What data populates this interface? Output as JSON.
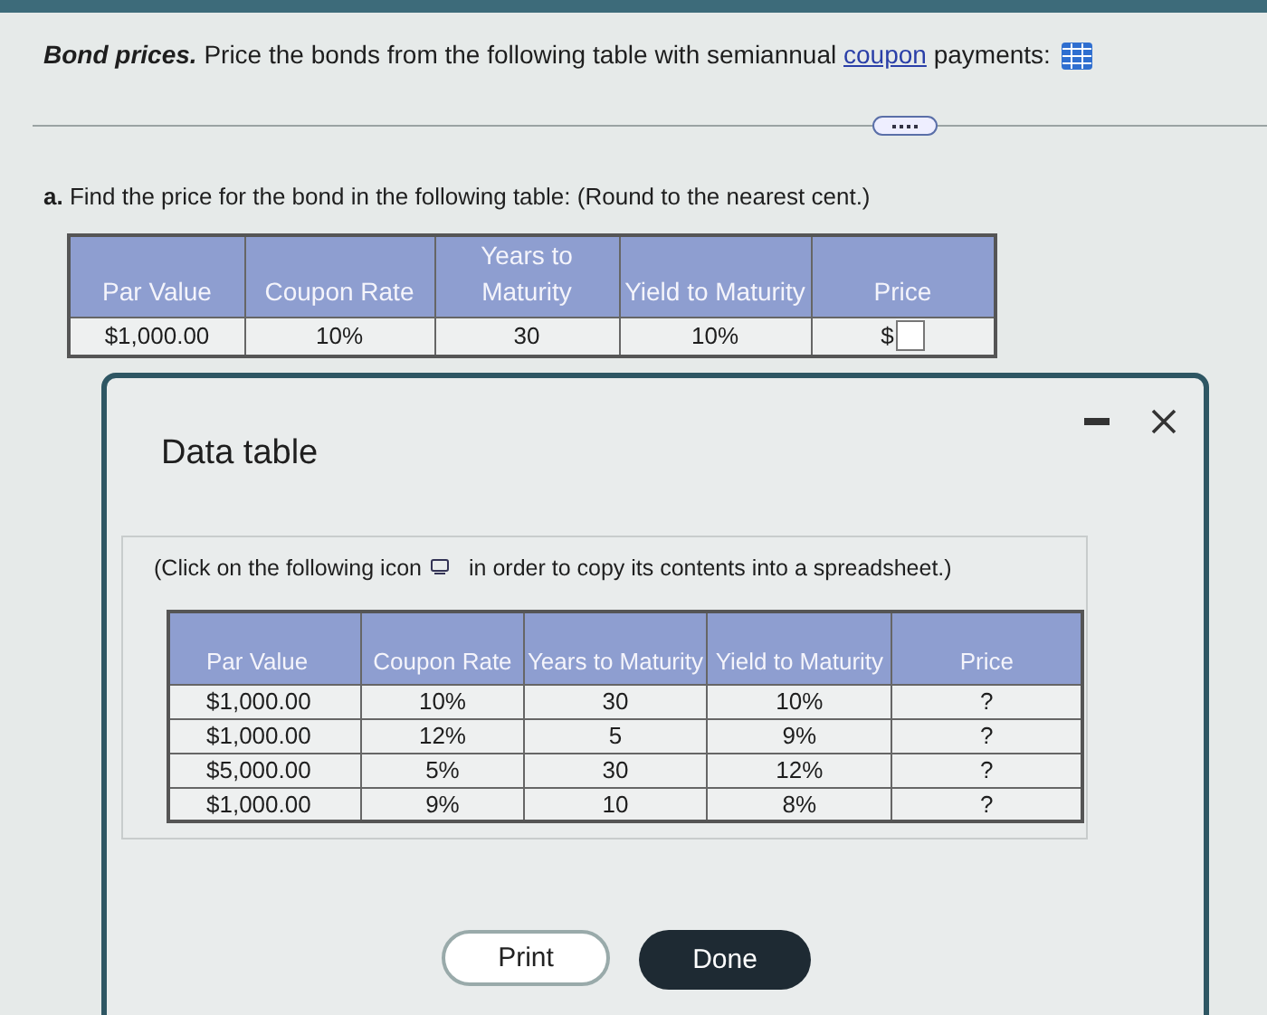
{
  "question": {
    "title": "Bond prices.",
    "text": "Price the bonds from the following table with semiannual",
    "link": "coupon",
    "text_after": "payments:"
  },
  "part_a": {
    "label": "a.",
    "prompt": "Find the price for the bond in the following table:",
    "note": "(Round to the nearest cent.)"
  },
  "bond_table": {
    "columns": [
      "Par Value",
      "Coupon Rate",
      "Years to Maturity",
      "Yield to Maturity",
      "Price"
    ],
    "rows": [
      {
        "cells": [
          "$1,000.00",
          "10%",
          "30",
          "10%"
        ],
        "price_prefix": "$"
      }
    ]
  },
  "dialog": {
    "title": "Data table",
    "instruction_before": "(Click on the following icon",
    "instruction_after": "in order to copy its contents into a spreadsheet.)",
    "columns": [
      "Par Value",
      "Coupon Rate",
      "Years to Maturity",
      "Yield to Maturity",
      "Price"
    ],
    "rows": [
      [
        "$1,000.00",
        "10%",
        "30",
        "10%",
        "?"
      ],
      [
        "$1,000.00",
        "12%",
        "5",
        "9%",
        "?"
      ],
      [
        "$5,000.00",
        "5%",
        "30",
        "12%",
        "?"
      ],
      [
        "$1,000.00",
        "9%",
        "10",
        "8%",
        "?"
      ]
    ],
    "buttons": [
      {
        "label": "Print",
        "kind": "secondary"
      },
      {
        "label": "Done",
        "kind": "primary"
      }
    ]
  }
}
